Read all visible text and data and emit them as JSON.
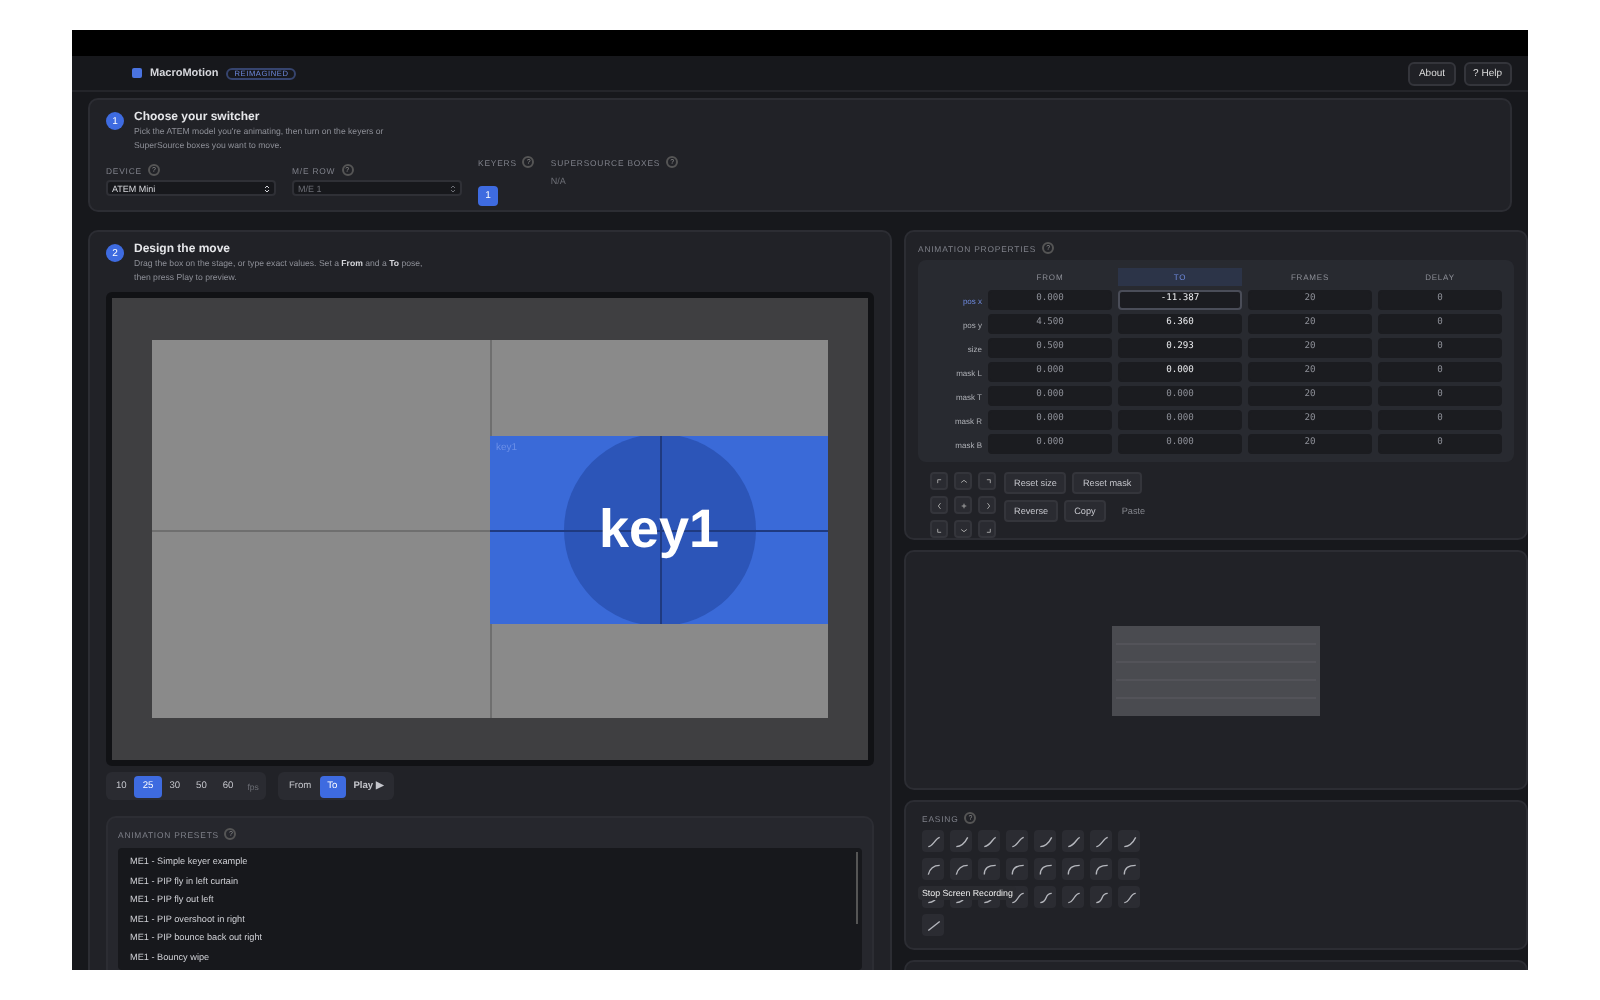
{
  "header": {
    "app_name": "MacroMotion",
    "badge": "REIMAGINED",
    "buttons": [
      "About",
      "? Help"
    ]
  },
  "step1": {
    "number": "1",
    "title": "Choose your switcher",
    "description": "Pick the ATEM model you're animating, then turn on the keyers or SuperSource boxes you want to move.",
    "device": {
      "label": "DEVICE",
      "help": "?",
      "value": "ATEM Mini",
      "disabled": false
    },
    "me_row": {
      "label": "M/E ROW",
      "help": "?",
      "value": "M/E 1",
      "disabled": true
    },
    "keyers": {
      "label": "KEYERS",
      "help": "?",
      "items": [
        {
          "label": "1",
          "selected": true
        }
      ]
    },
    "supersource": {
      "label": "SUPERSOURCE BOXES",
      "help": "?",
      "value": "N/A"
    }
  },
  "step2": {
    "number": "2",
    "title": "Design the move",
    "description": "Drag the box on the stage, or type exact values. Set a **From** and a **To** pose, then press Play to preview.",
    "stage": {
      "key_corner_label": "key1",
      "key_label": "key1"
    },
    "fps": {
      "options": [
        {
          "label": "10",
          "selected": false
        },
        {
          "label": "25",
          "selected": true
        },
        {
          "label": "30",
          "selected": false
        },
        {
          "label": "50",
          "selected": false
        },
        {
          "label": "60",
          "selected": false
        }
      ],
      "unit": "fps"
    },
    "pose": [
      {
        "label": "From",
        "selected": false
      },
      {
        "label": "To",
        "selected": true
      }
    ],
    "play": {
      "label": "Play",
      "icon": "▶"
    }
  },
  "presets": {
    "title": "ANIMATION PRESETS",
    "help": "?",
    "items": [
      "ME1 - Simple keyer example",
      "ME1 - PIP fly in left curtain",
      "ME1 - PIP fly out left",
      "ME1 - PIP overshoot in right",
      "ME1 - PIP bounce back out right",
      "ME1 - Bouncy wipe"
    ]
  },
  "properties": {
    "title": "ANIMATION PROPERTIES",
    "help": "?",
    "columns": [
      {
        "label": "FROM",
        "selected": false
      },
      {
        "label": "TO",
        "selected": true
      },
      {
        "label": "FRAMES",
        "selected": false
      },
      {
        "label": "DELAY",
        "selected": false
      }
    ],
    "rows": [
      {
        "label": "pos x",
        "selected": true,
        "from": "0.000",
        "to": "-11.387",
        "to_focused": true,
        "to_changed": true,
        "frames": "20",
        "delay": "0"
      },
      {
        "label": "pos y",
        "selected": false,
        "from": "4.500",
        "to": "6.360",
        "to_focused": false,
        "to_changed": true,
        "frames": "20",
        "delay": "0"
      },
      {
        "label": "size",
        "selected": false,
        "from": "0.500",
        "to": "0.293",
        "to_focused": false,
        "to_changed": true,
        "frames": "20",
        "delay": "0"
      },
      {
        "label": "mask L",
        "selected": false,
        "from": "0.000",
        "to": "0.000",
        "to_focused": false,
        "to_changed": true,
        "frames": "20",
        "delay": "0"
      },
      {
        "label": "mask T",
        "selected": false,
        "from": "0.000",
        "to": "0.000",
        "to_focused": false,
        "to_changed": false,
        "frames": "20",
        "delay": "0"
      },
      {
        "label": "mask R",
        "selected": false,
        "from": "0.000",
        "to": "0.000",
        "to_focused": false,
        "to_changed": false,
        "frames": "20",
        "delay": "0"
      },
      {
        "label": "mask B",
        "selected": false,
        "from": "0.000",
        "to": "0.000",
        "to_focused": false,
        "to_changed": false,
        "frames": "20",
        "delay": "0"
      }
    ],
    "buttons": [
      {
        "label": "Reset size",
        "disabled": false
      },
      {
        "label": "Reset mask",
        "disabled": false
      },
      {
        "label": "Reverse",
        "disabled": false
      },
      {
        "label": "Copy",
        "disabled": false
      },
      {
        "label": "Paste",
        "disabled": true
      }
    ]
  },
  "easing": {
    "title": "EASING",
    "help": "?"
  },
  "tooltip": "Stop Screen Recording"
}
